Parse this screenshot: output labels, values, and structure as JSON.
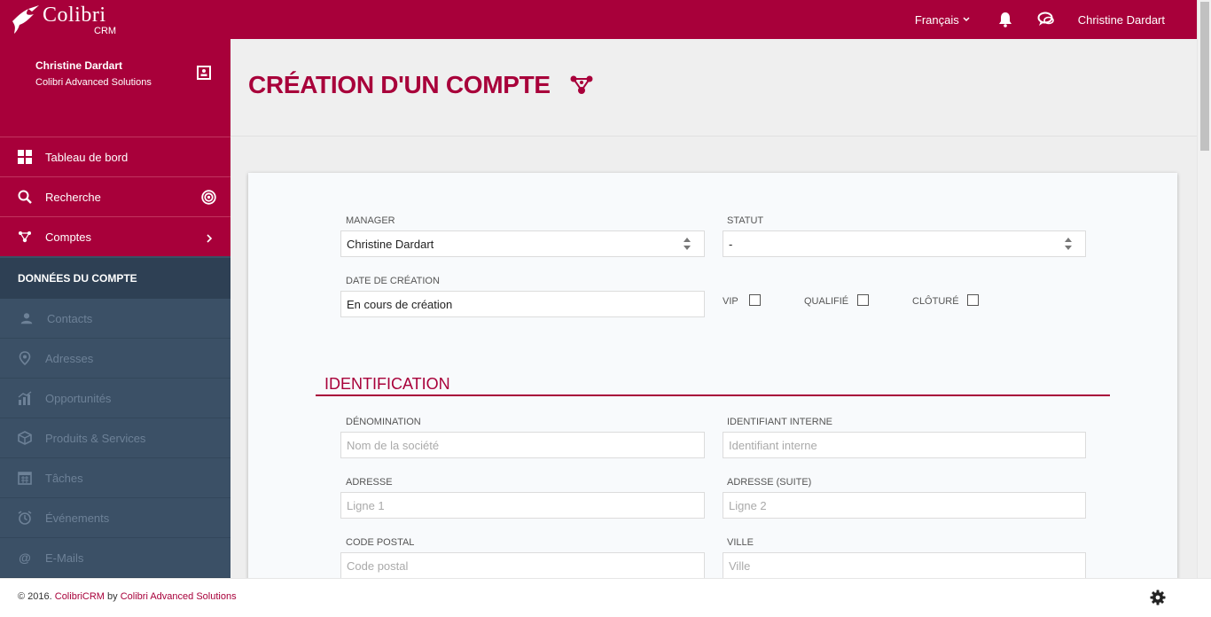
{
  "topbar": {
    "brand": "Colibri",
    "brand_sub": "CRM",
    "language": "Français",
    "user": "Christine Dardart"
  },
  "sidebar": {
    "profile_name": "Christine Dardart",
    "profile_company": "Colibri Advanced Solutions",
    "primary_items": [
      {
        "label": "Tableau de bord",
        "icon": "dashboard-icon"
      },
      {
        "label": "Recherche",
        "icon": "search-icon"
      },
      {
        "label": "Comptes",
        "icon": "accounts-icon"
      }
    ],
    "section_title": "DONNÉES DU COMPTE",
    "sub_items": [
      {
        "label": "Contacts",
        "icon": "contacts-icon"
      },
      {
        "label": "Adresses",
        "icon": "location-icon"
      },
      {
        "label": "Opportunités",
        "icon": "chart-icon"
      },
      {
        "label": "Produits & Services",
        "icon": "box-icon"
      },
      {
        "label": "Tâches",
        "icon": "calendar-icon"
      },
      {
        "label": "Événements",
        "icon": "alarm-icon"
      },
      {
        "label": "E-Mails",
        "icon": "at-icon"
      }
    ]
  },
  "page": {
    "title": "CRÉATION D'UN COMPTE"
  },
  "form": {
    "manager_label": "MANAGER",
    "manager_value": "Christine Dardart",
    "statut_label": "STATUT",
    "statut_value": "-",
    "date_label": "DATE DE CRÉATION",
    "date_value": "En cours de création",
    "vip_label": "VIP",
    "qualifie_label": "QUALIFIÉ",
    "cloture_label": "CLÔTURÉ",
    "vip_checked": false,
    "qualifie_checked": false,
    "cloture_checked": false,
    "section_identification": "IDENTIFICATION",
    "denomination_label": "DÉNOMINATION",
    "denomination_placeholder": "Nom de la société",
    "identifiant_label": "IDENTIFIANT INTERNE",
    "identifiant_placeholder": "Identifiant interne",
    "adresse_label": "ADRESSE",
    "adresse_placeholder": "Ligne 1",
    "adresse_suite_label": "ADRESSE (SUITE)",
    "adresse_suite_placeholder": "Ligne 2",
    "code_postal_label": "CODE POSTAL",
    "code_postal_placeholder": "Code postal",
    "ville_label": "VILLE",
    "ville_placeholder": "Ville"
  },
  "footer": {
    "copyright_prefix": "© 2016. ",
    "product_link": "ColibriCRM",
    "by_text": " by ",
    "company_link": "Colibri Advanced Solutions"
  },
  "colors": {
    "brand": "#a8003a",
    "sidebar_dark": "#3b5066",
    "sidebar_section": "#2e4054"
  }
}
